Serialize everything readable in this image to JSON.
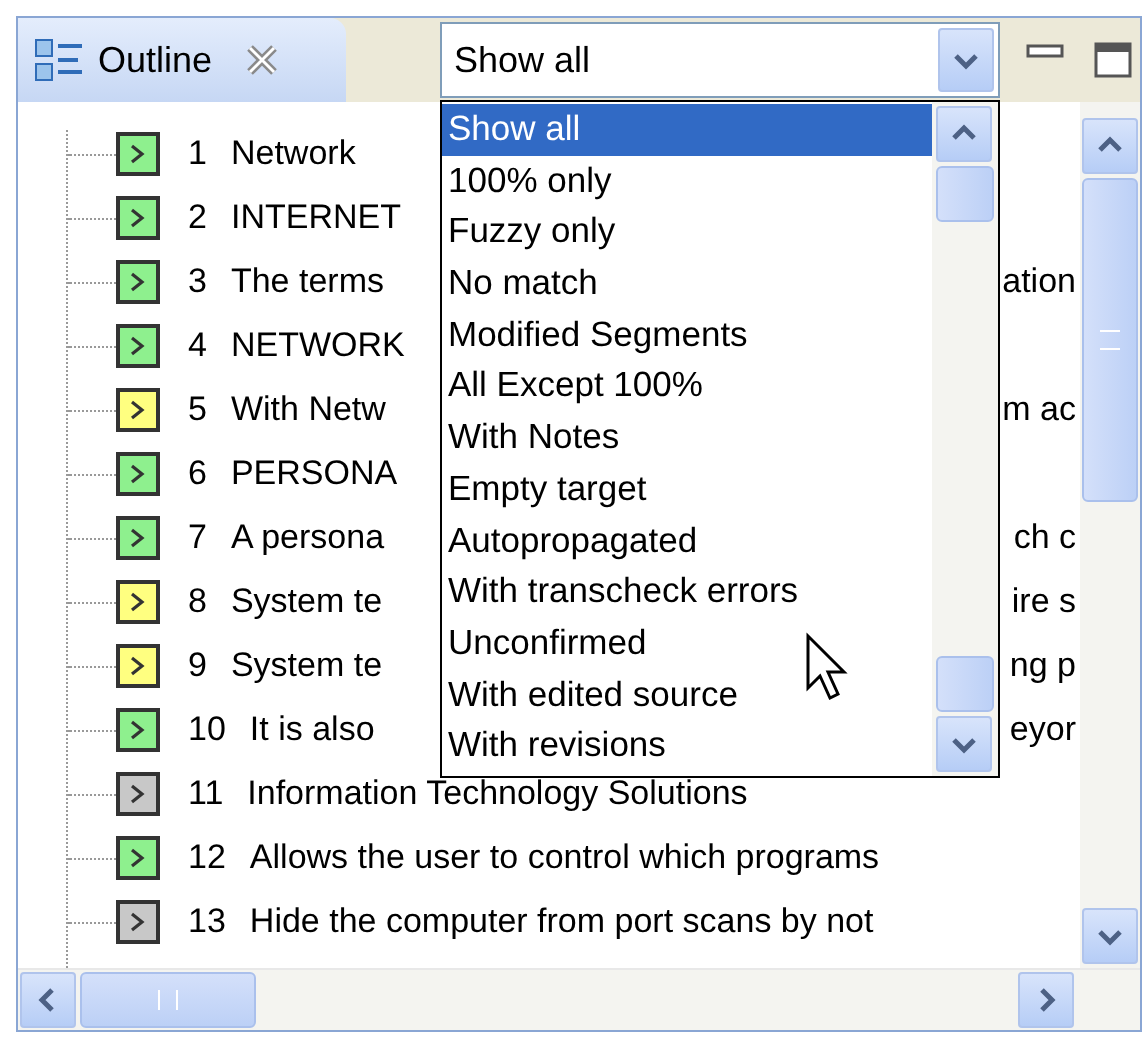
{
  "tab": {
    "label": "Outline",
    "selected": true
  },
  "filter": {
    "value": "Show all"
  },
  "dropdown": {
    "items": [
      {
        "label": "Show all",
        "selected": true
      },
      {
        "label": "100% only",
        "selected": false
      },
      {
        "label": "Fuzzy only",
        "selected": false
      },
      {
        "label": "No match",
        "selected": false
      },
      {
        "label": "Modified Segments",
        "selected": false
      },
      {
        "label": "All Except 100%",
        "selected": false
      },
      {
        "label": "With Notes",
        "selected": false
      },
      {
        "label": "Empty target",
        "selected": false
      },
      {
        "label": "Autopropagated",
        "selected": false
      },
      {
        "label": "With transcheck errors",
        "selected": false
      },
      {
        "label": "Unconfirmed",
        "selected": false
      },
      {
        "label": "With edited source",
        "selected": false
      },
      {
        "label": "With revisions",
        "selected": false
      }
    ]
  },
  "rows": [
    {
      "number": "1",
      "text": "Network",
      "color": "#8ef08e"
    },
    {
      "number": "2",
      "text": "INTERNET",
      "color": "#8ef08e"
    },
    {
      "number": "3",
      "text": "The terms",
      "text_right": "ation",
      "color": "#8ef08e"
    },
    {
      "number": "4",
      "text": "NETWORK",
      "color": "#8ef08e"
    },
    {
      "number": "5",
      "text": "With Netw",
      "text_right": "m ac",
      "color": "#ffff80"
    },
    {
      "number": "6",
      "text": "PERSONA",
      "color": "#8ef08e"
    },
    {
      "number": "7",
      "text": "A persona",
      "text_right": "ch c",
      "color": "#8ef08e"
    },
    {
      "number": "8",
      "text": "System te",
      "text_right": "ire s",
      "color": "#ffff80"
    },
    {
      "number": "9",
      "text": "System te",
      "text_right": "ng p",
      "color": "#ffff80"
    },
    {
      "number": "10",
      "text": "It is also",
      "text_right": "eyor",
      "color": "#8ef08e"
    },
    {
      "number": "11",
      "text": "Information Technology Solutions",
      "color": "#c8c8c8"
    },
    {
      "number": "12",
      "text": "Allows the user to control which programs",
      "color": "#8ef08e"
    },
    {
      "number": "13",
      "text": "Hide the computer from port scans by not",
      "color": "#c8c8c8"
    }
  ]
}
